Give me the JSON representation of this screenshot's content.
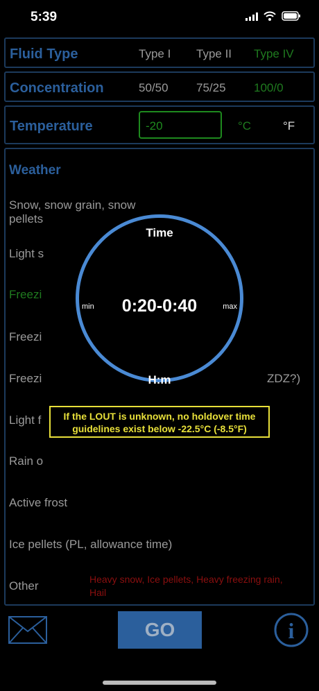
{
  "status": {
    "time": "5:39",
    "icons": [
      "signal-icon",
      "wifi-icon",
      "battery-icon"
    ]
  },
  "fluid": {
    "title": "Fluid Type",
    "options": [
      "Type I",
      "Type II",
      "Type IV"
    ],
    "selected": "Type IV"
  },
  "concentration": {
    "title": "Concentration",
    "options": [
      "50/50",
      "75/25",
      "100/0"
    ],
    "selected": "100/0"
  },
  "temperature": {
    "title": "Temperature",
    "value": "-20",
    "units": [
      "°C",
      "°F"
    ],
    "selected_unit": "°C"
  },
  "weather": {
    "title": "Weather",
    "items": [
      "Snow, snow grain, snow pellets",
      "Light s",
      "Freezi",
      "Freezi",
      "Freezi",
      "ZDZ?)",
      "Light f",
      "Rain o",
      "Active frost",
      "Ice pellets (PL, allowance time)",
      "Other"
    ],
    "other_note": "Heavy snow, Ice pellets, Heavy freezing rain, Hail"
  },
  "popup": {
    "time_label": "Time",
    "value": "0:20-0:40",
    "min_label": "min",
    "max_label": "max",
    "unit_label": "H:m"
  },
  "warning": "If the LOUT is unknown, no holdover time guidelines exist below -22.5°C (-8.5°F)",
  "bottom": {
    "go_label": "GO",
    "mail_icon": "mail-icon",
    "info_icon": "info-icon"
  },
  "colors": {
    "accent": "#2b5f9c",
    "selected": "#1f7a1f",
    "warning": "#e8e03a",
    "ring": "#4a8ad4",
    "note": "#8b0f0f"
  }
}
